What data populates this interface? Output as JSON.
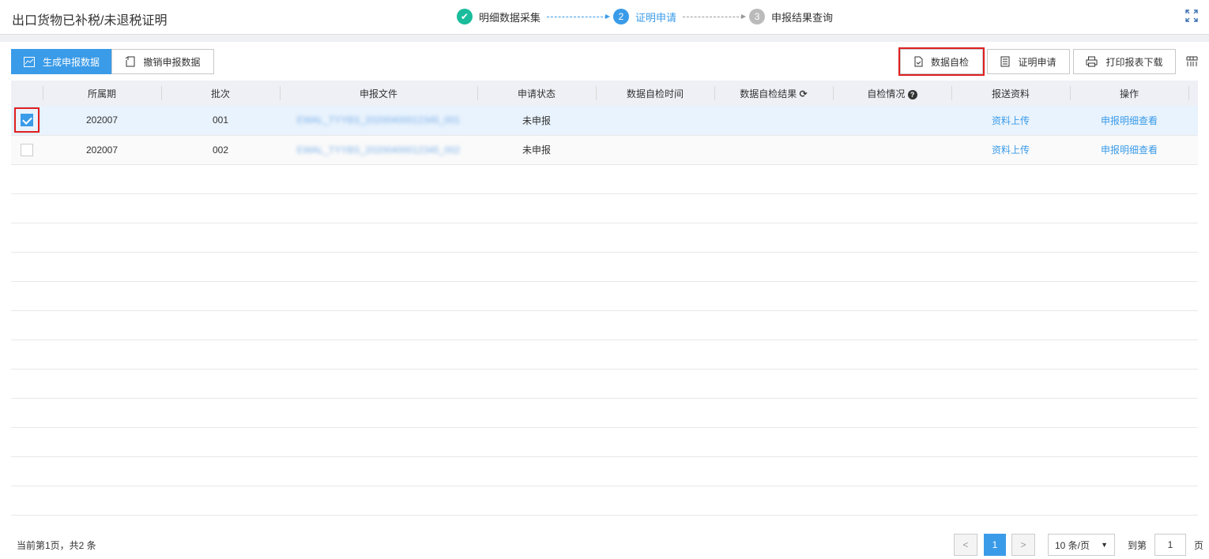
{
  "header": {
    "title": "出口货物已补税/未退税证明",
    "steps": [
      {
        "num": "1",
        "label": "明细数据采集",
        "state": "done"
      },
      {
        "num": "2",
        "label": "证明申请",
        "state": "active"
      },
      {
        "num": "3",
        "label": "申报结果查询",
        "state": "pending"
      }
    ]
  },
  "toolbar": {
    "generate": "生成申报数据",
    "revoke": "撤销申报数据",
    "self_check": "数据自检",
    "apply": "证明申请",
    "print": "打印报表下载"
  },
  "table": {
    "columns": [
      "所属期",
      "批次",
      "申报文件",
      "申请状态",
      "数据自检时间",
      "数据自检结果",
      "自检情况",
      "报送资料",
      "操作"
    ],
    "rows": [
      {
        "checked": true,
        "period": "202007",
        "batch": "001",
        "file": "EWAL_TYYBS_20200400012345_001",
        "status": "未申报",
        "time": "",
        "result": "",
        "situation": "",
        "upload": "资料上传",
        "action": "申报明细查看"
      },
      {
        "checked": false,
        "period": "202007",
        "batch": "002",
        "file": "EWAL_TYYBS_20200400012345_002",
        "status": "未申报",
        "time": "",
        "result": "",
        "situation": "",
        "upload": "资料上传",
        "action": "申报明细查看"
      }
    ]
  },
  "pagination": {
    "summary": "当前第1页，共2 条",
    "current": "1",
    "page_size": "10 条/页",
    "goto_label": "到第",
    "goto_value": "1",
    "page_suffix": "页"
  },
  "colors": {
    "accent": "#3a9be8",
    "done": "#1abc9c",
    "highlight": "#e02020"
  }
}
